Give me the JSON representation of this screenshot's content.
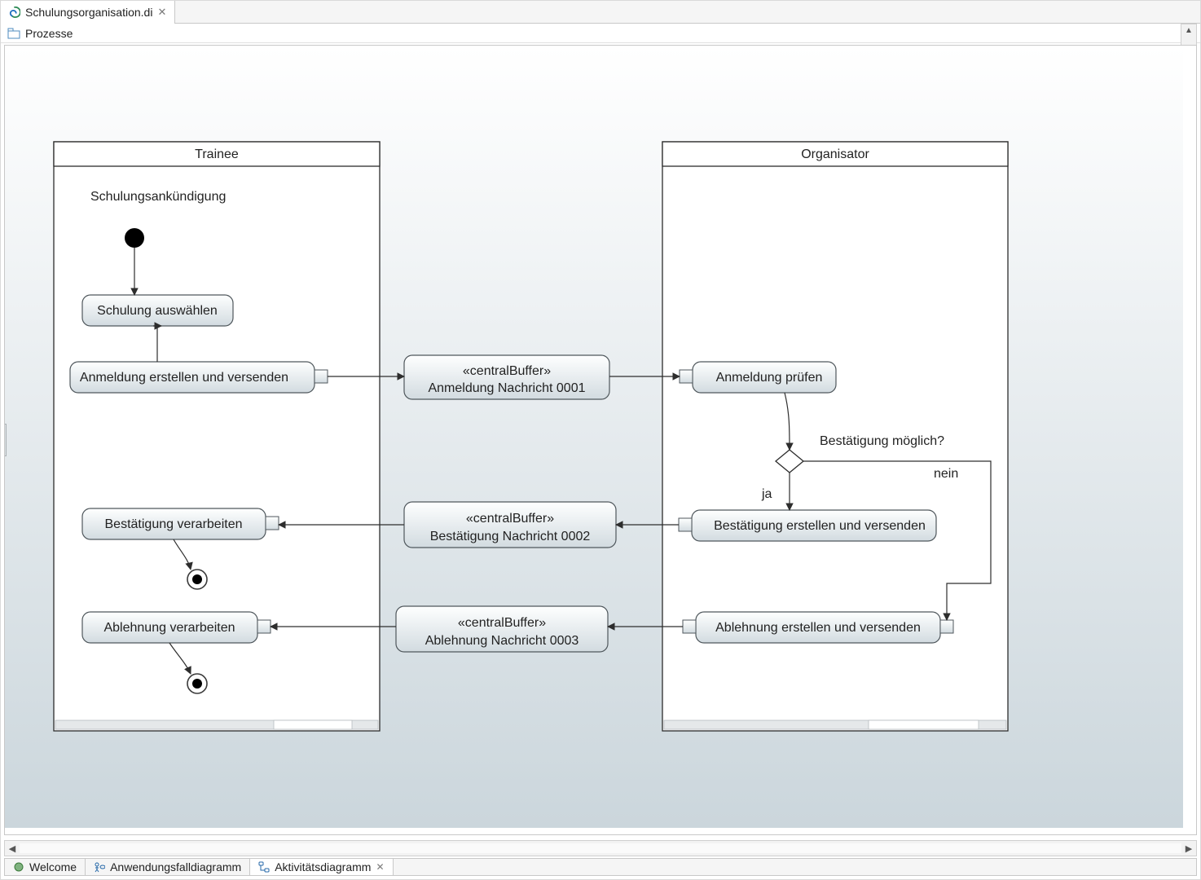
{
  "topTab": {
    "title": "Schulungsorganisation.di"
  },
  "breadcrumb": {
    "label": "Prozesse"
  },
  "partitions": {
    "trainee": "Trainee",
    "organisator": "Organisator"
  },
  "labels": {
    "announcement": "Schulungsankündigung",
    "decision": "Bestätigung möglich?",
    "guard_yes": "ja",
    "guard_no": "nein"
  },
  "actions": {
    "select": "Schulung auswählen",
    "createReg": "Anmeldung erstellen und versenden",
    "checkReg": "Anmeldung prüfen",
    "createConf": "Bestätigung erstellen und versenden",
    "createRej": "Ablehnung erstellen und versenden",
    "procConf": "Bestätigung verarbeiten",
    "procRej": "Ablehnung verarbeiten"
  },
  "buffers": {
    "b1_stereo": "«centralBuffer»",
    "b1_name": "Anmeldung Nachricht 0001",
    "b2_stereo": "«centralBuffer»",
    "b2_name": "Bestätigung Nachricht 0002",
    "b3_stereo": "«centralBuffer»",
    "b3_name": "Ablehnung Nachricht 0003"
  },
  "bottomTabs": {
    "welcome": "Welcome",
    "useCase": "Anwendungsfalldiagramm",
    "activity": "Aktivitätsdiagramm"
  }
}
